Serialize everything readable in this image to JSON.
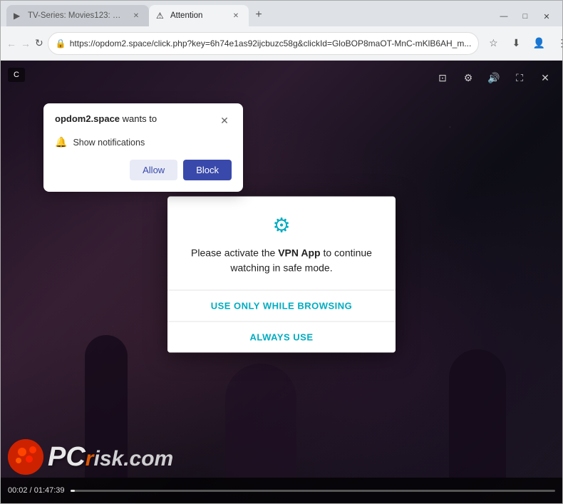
{
  "browser": {
    "tabs": [
      {
        "id": "tab1",
        "title": "TV-Series: Movies123: Watch T...",
        "favicon": "▶",
        "active": false
      },
      {
        "id": "tab2",
        "title": "Attention",
        "favicon": "⚠",
        "active": true
      }
    ],
    "new_tab_label": "+",
    "window_controls": {
      "minimize": "—",
      "maximize": "□",
      "close": "✕"
    },
    "nav": {
      "back": "←",
      "forward": "→",
      "refresh": "↻"
    },
    "url": "https://opdom2.space/click.php?key=6h74e1as92ijcbuzc58g&clickId=GloBOP8maOT-MnC-mKlB6AH_m...",
    "address_actions": {
      "star": "☆",
      "download": "⬇",
      "profile": "👤",
      "menu": "⋮"
    }
  },
  "notification_popup": {
    "title_prefix": "opdom2.space",
    "title_suffix": " wants to",
    "close_icon": "✕",
    "bell_icon": "🔔",
    "notification_label": "Show notifications",
    "allow_button": "Allow",
    "block_button": "Block"
  },
  "vpn_modal": {
    "gear_icon": "⚙",
    "body_text_prefix": "Please activate the ",
    "body_text_bold": "VPN App",
    "body_text_suffix": " to continue watching in safe mode.",
    "button1": "USE ONLY WHILE BROWSING",
    "button2": "ALWAYS USE"
  },
  "video_player": {
    "time_current": "00:02",
    "time_total": "01:47:39",
    "ctrl_monitor": "⊡",
    "ctrl_settings": "⚙",
    "ctrl_volume": "🔊",
    "ctrl_fullscreen": "⛶",
    "ctrl_close": "✕"
  },
  "watermark": {
    "logo_symbol": "●",
    "pc_text": "PC",
    "domain": "risk.com"
  },
  "colors": {
    "accent_blue": "#3949ab",
    "accent_cyan": "#00acc1",
    "btn_allow_bg": "#e8eaf6",
    "btn_allow_text": "#3949ab",
    "btn_block_bg": "#3949ab",
    "btn_block_text": "#ffffff"
  }
}
